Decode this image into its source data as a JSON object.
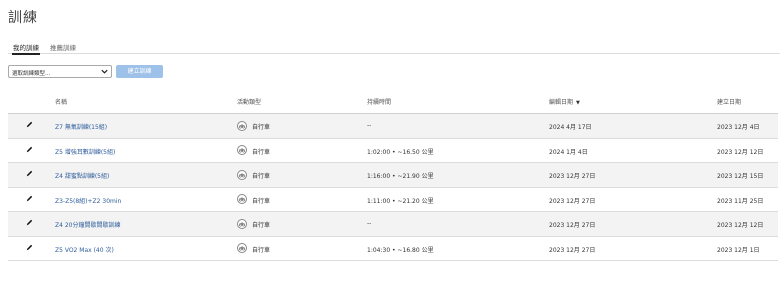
{
  "page": {
    "title": "訓練"
  },
  "tabs": [
    {
      "label": "我的訓練",
      "active": true
    },
    {
      "label": "推薦訓練",
      "active": false
    }
  ],
  "toolbar": {
    "select_value": "選取訓練類型...",
    "create_button": "建立訓練",
    "create_button_color": "#9dc1e8"
  },
  "table": {
    "headers": {
      "name": "名稱",
      "activity_type": "活動類型",
      "duration": "持續時間",
      "edited_date": "編輯日期",
      "created_date": "建立日期"
    },
    "sorted_by": "edited_date",
    "sort_direction": "descending",
    "rows": [
      {
        "name": "Z7 無氧訓練(15組)",
        "activity": "自行車",
        "duration": "--",
        "edited": "2024 4月 17日",
        "created": "2023 12月 4日"
      },
      {
        "name": "Z5 增強耳數訓練(5組)",
        "activity": "自行車",
        "duration": "1:02:00 • ~16.50 公里",
        "edited": "2024 1月 4日",
        "created": "2023 12月 12日"
      },
      {
        "name": "Z4 甜蜜點訓練(5組)",
        "activity": "自行車",
        "duration": "1:16:00 • ~21.90 公里",
        "edited": "2023 12月 27日",
        "created": "2023 12月 15日"
      },
      {
        "name": "Z3-Z5(8組)+Z2 30min",
        "activity": "自行車",
        "duration": "1:11:00 • ~21.20 公里",
        "edited": "2023 12月 27日",
        "created": "2023 11月 25日"
      },
      {
        "name": "Z4 20分鐘間歇間歇訓練",
        "activity": "自行車",
        "duration": "--",
        "edited": "2023 12月 27日",
        "created": "2023 12月 12日"
      },
      {
        "name": "Z5 VO2 Max (40 次)",
        "activity": "自行車",
        "duration": "1:04:30 • ~16.80 公里",
        "edited": "2023 12月 27日",
        "created": "2023 12月 1日"
      }
    ]
  },
  "icons": {
    "edit": "pencil-icon",
    "activity": "bicycle-icon",
    "select_chevron": "chevron-down-icon",
    "sort": "sort-descending-icon"
  },
  "colors": {
    "link": "#2f5d9b",
    "row_shade": "#f3f3f3"
  }
}
